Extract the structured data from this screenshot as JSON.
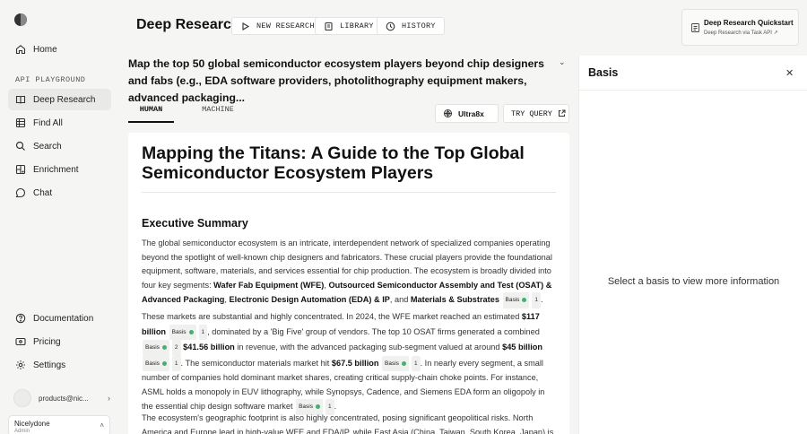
{
  "sidebar": {
    "nav_top": [
      {
        "label": "Home",
        "icon": "home-icon"
      }
    ],
    "section_label": "API PLAYGROUND",
    "playground_items": [
      {
        "label": "Deep Research",
        "icon": "book-icon",
        "active": true
      },
      {
        "label": "Find All",
        "icon": "table-icon"
      },
      {
        "label": "Search",
        "icon": "search-icon"
      },
      {
        "label": "Enrichment",
        "icon": "enrichment-icon"
      },
      {
        "label": "Chat",
        "icon": "chat-icon"
      }
    ],
    "bottom_items": [
      {
        "label": "Documentation",
        "icon": "help-icon"
      },
      {
        "label": "Pricing",
        "icon": "credit-card-icon"
      },
      {
        "label": "Settings",
        "icon": "gear-icon"
      }
    ],
    "account_email": "products@nic...",
    "org_name": "Nicelydone",
    "org_role": "Admin"
  },
  "header": {
    "title": "Deep Research",
    "new_research": "NEW RESEARCH",
    "library": "LIBRARY",
    "history": "HISTORY"
  },
  "quickstart": {
    "title": "Deep Research Quickstart",
    "subtitle": "Deep Research via Task API"
  },
  "query": "Map the top 50 global semiconductor ecosystem players beyond chip designers and fabs (e.g., EDA software providers, photolithography equipment makers, advanced packaging...",
  "tabs": {
    "human": "HUMAN",
    "machine": "MACHINE"
  },
  "model": "Ultra8x",
  "try_query": "TRY QUERY",
  "report": {
    "title": "Mapping the Titans: A Guide to the Top Global Semiconductor Ecosystem Players",
    "section_heading": "Executive Summary",
    "badge_label": "Basis",
    "p1": {
      "text": "The global semiconductor ecosystem is an intricate, interdependent network of specialized companies operating beyond the spotlight of well-known chip designers and fabricators. These crucial players provide the foundational equipment, software, materials, and services essential for chip production. The ecosystem is broadly divided into four key segments: ",
      "seg1": "Wafer Fab Equipment (WFE)",
      "sep1": ", ",
      "seg2": "Outsourced Semiconductor Assembly and Test (OSAT) & Advanced Packaging",
      "sep2": ", ",
      "seg3": "Electronic Design Automation (EDA) & IP",
      "sep3": ", and ",
      "seg4": "Materials & Substrates",
      "count": "1",
      "end": "."
    },
    "p2": {
      "t1": "These markets are substantial and highly concentrated. In 2024, the WFE market reached an estimated ",
      "b1": "$117 billion",
      "c1": "1",
      "t2": ", dominated by a 'Big Five' group of vendors. The top 10 OSAT firms generated a combined ",
      "c2": "2",
      "b2": "$41.56 billion",
      "t3": " in revenue, with the advanced packaging sub-segment valued at around ",
      "b3": "$45 billion",
      "c3": "1",
      "t4": ". The semiconductor materials market hit ",
      "b4": "$67.5 billion",
      "c4": "1",
      "t5": ". In nearly every segment, a small number of companies hold dominant market shares, creating critical supply-chain choke points. For instance, ASML holds a monopoly in EUV lithography, while Synopsys, Cadence, and Siemens EDA form an oligopoly in the essential chip design software market",
      "c5": "1",
      "end": "."
    },
    "p3": "The ecosystem's geographic footprint is also highly concentrated, posing significant geopolitical risks. North America and Europe lead in high-value WFE and EDA/IP, while East Asia (China, Taiwan, South Korea, Japan) is the global"
  },
  "panel": {
    "title": "Basis",
    "empty_message": "Select a basis to view more information"
  }
}
